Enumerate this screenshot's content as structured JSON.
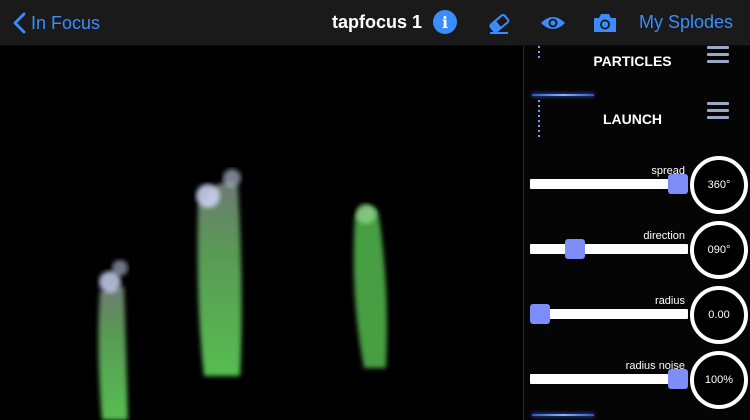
{
  "navbar": {
    "back_label": "In Focus",
    "title": "tapfocus 1",
    "info_glyph": "i",
    "my_splodes_label": "My Splodes",
    "accent_color": "#3a8cff"
  },
  "panel": {
    "sections": [
      {
        "title": "PARTICLES"
      },
      {
        "title": "LAUNCH"
      }
    ],
    "sliders": [
      {
        "label": "spread",
        "value": "360°",
        "level": 1.0
      },
      {
        "label": "direction",
        "value": "090°",
        "level": 0.25
      },
      {
        "label": "radius",
        "value": "0.00",
        "level": 0.0
      },
      {
        "label": "radius noise",
        "value": "100%",
        "level": 1.0
      }
    ],
    "thumb_color": "#7c8cf8"
  },
  "canvas": {
    "background": "#000000",
    "trail_color": "#5fd35a",
    "head_color": "#c8d0f0"
  }
}
